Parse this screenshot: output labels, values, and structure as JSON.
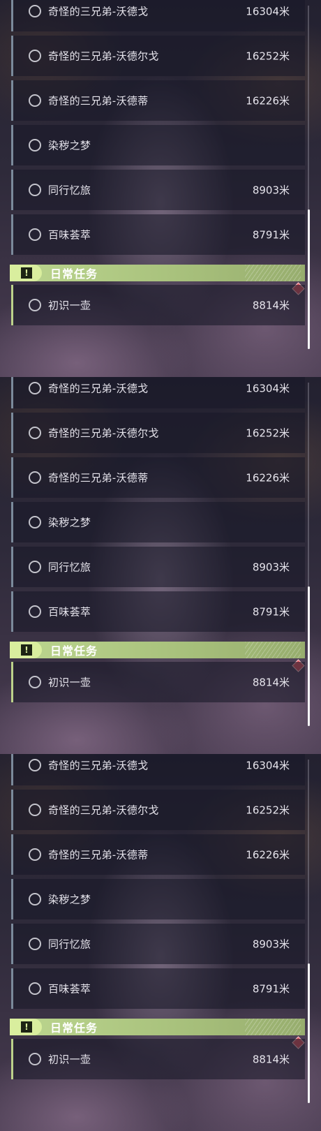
{
  "colors": {
    "item_bar": "#7b8a9b",
    "daily_bar": "#bcd28a",
    "header_green": "#bcd68f",
    "marker_red": "#e05a63"
  },
  "icons": {
    "item_status": "radio-circle-icon",
    "section": "exclamation-icon",
    "marker": "red-diamond-icon"
  },
  "panels": [
    {
      "items": [
        {
          "name": "奇怪的三兄弟-沃德戈",
          "distance": "16304米"
        },
        {
          "name": "奇怪的三兄弟-沃德尔戈",
          "distance": "16252米"
        },
        {
          "name": "奇怪的三兄弟-沃德蒂",
          "distance": "16226米"
        },
        {
          "name": "染秽之梦",
          "distance": ""
        },
        {
          "name": "同行忆旅",
          "distance": "8903米"
        },
        {
          "name": "百味荟萃",
          "distance": "8791米"
        }
      ],
      "section": {
        "title": "日常任务"
      },
      "daily_item": {
        "name": "初识一壶",
        "distance": "8814米"
      }
    },
    {
      "items": [
        {
          "name": "奇怪的三兄弟-沃德戈",
          "distance": "16304米"
        },
        {
          "name": "奇怪的三兄弟-沃德尔戈",
          "distance": "16252米"
        },
        {
          "name": "奇怪的三兄弟-沃德蒂",
          "distance": "16226米"
        },
        {
          "name": "染秽之梦",
          "distance": ""
        },
        {
          "name": "同行忆旅",
          "distance": "8903米"
        },
        {
          "name": "百味荟萃",
          "distance": "8791米"
        }
      ],
      "section": {
        "title": "日常任务"
      },
      "daily_item": {
        "name": "初识一壶",
        "distance": "8814米"
      }
    },
    {
      "items": [
        {
          "name": "奇怪的三兄弟-沃德戈",
          "distance": "16304米"
        },
        {
          "name": "奇怪的三兄弟-沃德尔戈",
          "distance": "16252米"
        },
        {
          "name": "奇怪的三兄弟-沃德蒂",
          "distance": "16226米"
        },
        {
          "name": "染秽之梦",
          "distance": ""
        },
        {
          "name": "同行忆旅",
          "distance": "8903米"
        },
        {
          "name": "百味荟萃",
          "distance": "8791米"
        }
      ],
      "section": {
        "title": "日常任务"
      },
      "daily_item": {
        "name": "初识一壶",
        "distance": "8814米"
      }
    }
  ]
}
